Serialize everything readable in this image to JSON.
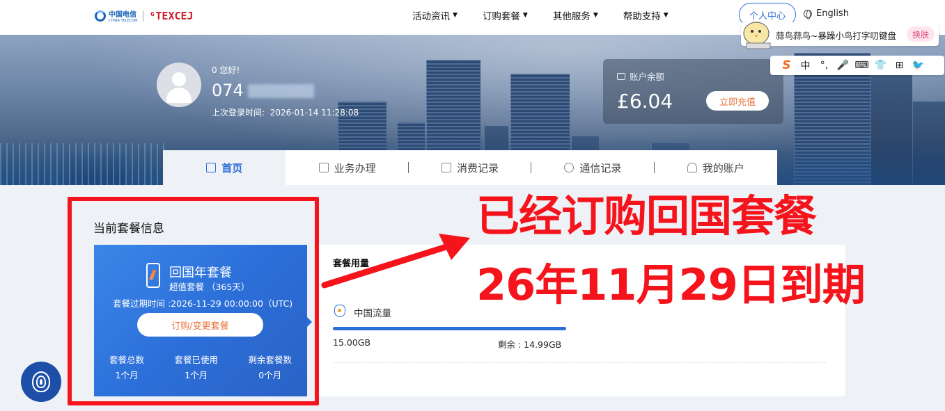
{
  "header": {
    "logo_ct_text": "中国电信",
    "logo_ct_sub": "CHINA TELECOM",
    "logo_brand": "ᴳTEXCEJ",
    "nav": [
      "活动资讯",
      "订购套餐",
      "其他服务",
      "帮助支持"
    ],
    "personal_center": "个人中心",
    "language": "English"
  },
  "ime": {
    "status_text": "蒜鸟蒜鸟~暴躁小鸟打字叨键盘",
    "skin_label": "换肤",
    "toolbar": [
      "S",
      "中",
      "°,",
      "🎤",
      "⌨",
      "👕",
      "⊞",
      "🐦"
    ]
  },
  "user": {
    "greeting": "0 您好!",
    "phone_prefix": "074",
    "last_login_label": "上次登录时间:",
    "last_login_value": "2026-01-14 11:28:08"
  },
  "balance": {
    "label": "账户余额",
    "amount": "£6.04",
    "recharge_label": "立即充值"
  },
  "tabs": [
    {
      "label": "首页",
      "active": true
    },
    {
      "label": "业务办理",
      "active": false
    },
    {
      "label": "消费记录",
      "active": false
    },
    {
      "label": "通信记录",
      "active": false
    },
    {
      "label": "我的账户",
      "active": false
    }
  ],
  "plan": {
    "section_title": "当前套餐信息",
    "name": "回国年套餐",
    "subtitle": "超值套餐 （365天）",
    "expiry": "套餐过期时间 :2026-11-29 00:00:00（UTC)",
    "button": "订购/变更套餐",
    "stats": [
      {
        "label": "套餐总数",
        "value": "1个月"
      },
      {
        "label": "套餐已使用",
        "value": "1个月"
      },
      {
        "label": "剩余套餐数",
        "value": "0个月"
      }
    ]
  },
  "usage": {
    "title": "套餐用量",
    "item_name": "中国流量",
    "total": "15.00GB",
    "remaining": "剩余 : 14.99GB",
    "fill_fraction": 0.999
  },
  "annotation": {
    "line1": "已经订购回国套餐",
    "line2": "26年11月29日到期"
  },
  "colors": {
    "accent": "#2b6ed8",
    "annotation_red": "#f5141c",
    "button_text": "#e8743b"
  }
}
